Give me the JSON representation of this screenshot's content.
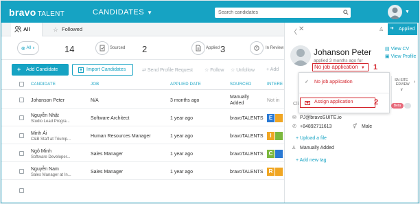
{
  "brand": {
    "logo_main": "bravo",
    "logo_sub": "TALENT",
    "module": "CANDIDATES"
  },
  "search": {
    "placeholder": "Search candidates"
  },
  "tabs": [
    {
      "label": "All"
    },
    {
      "label": "Followed"
    }
  ],
  "stats": [
    {
      "label": "All",
      "count": "14"
    },
    {
      "label": "Sourced",
      "count": "2"
    },
    {
      "label": "Applied",
      "count": "3"
    },
    {
      "label": "In Review",
      "count": ""
    }
  ],
  "toolbar": {
    "add": "Add Candidate",
    "import": "Import Candidates",
    "send": "Send Profile Request",
    "follow": "Follow",
    "unfollow": "Unfollow",
    "add_more": "Add"
  },
  "table": {
    "headers": [
      "CANDIDATE",
      "JOB",
      "APPLIED DATE",
      "SOURCED",
      "INTERE"
    ],
    "rows": [
      {
        "name": "Johanson Peter",
        "sub": "",
        "job": "N/A",
        "date": "3 months ago",
        "source": "Manually",
        "source2": "Added",
        "badge": "Not in",
        "badge_color": "#ffffff"
      },
      {
        "name": "Nguyễn Nhật",
        "sub": "Studio Lead Progra...",
        "job": "Software Architect",
        "date": "1 year ago",
        "source": "bravoTALENTS",
        "source2": "",
        "badge": "E",
        "badge_color": "#2979d4"
      },
      {
        "name": "Minh Ái",
        "sub": "C&B Staff at Triump...",
        "job": "Human Resources Manager",
        "date": "1 year ago",
        "source": "bravoTALENTS",
        "source2": "",
        "badge": "I",
        "badge_color": "#f0a623"
      },
      {
        "name": "Ngô Minh",
        "sub": "Software Developer...",
        "job": "Sales Manager",
        "date": "1 year ago",
        "source": "bravoTALENTS",
        "source2": "",
        "badge": "C",
        "badge_color": "#7cb83e"
      },
      {
        "name": "Nguyễn Nam",
        "sub": "Sales Manager at In...",
        "job": "Sales Manager",
        "date": "1 year ago",
        "source": "bravoTALENTS",
        "source2": "",
        "badge": "R",
        "badge_color": "#f0a623"
      }
    ]
  },
  "panel": {
    "applied": "Applied",
    "name": "Johanson Peter",
    "applied_text": "applied 3 months ago for",
    "no_job": "No job application",
    "view_cv": "View CV",
    "view_profile": "View Profile",
    "dd_no_job": "No job application",
    "dd_assign": "Assign application",
    "anno1": "1",
    "anno2": "2",
    "site_label": "SN SITE",
    "interview_label": "ERVIEW",
    "email": "PJ@bravoSUITE.io",
    "phone": "+84892711613",
    "gender": "Male",
    "upload": "+ Upload a file",
    "manual": "Manually Added",
    "tag": "+ Add new tag",
    "beta": "Beta",
    "cli": "Cli"
  }
}
